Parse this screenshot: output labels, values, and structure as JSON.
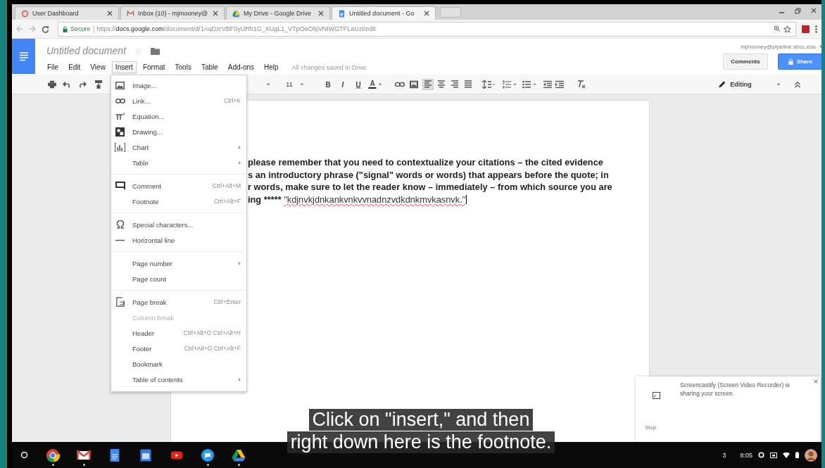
{
  "browser": {
    "tabs": [
      {
        "title": "User Dashboard",
        "selected": false
      },
      {
        "title": "Inbox (10) - mjmooney@",
        "selected": false
      },
      {
        "title": "My Drive - Google Drive",
        "selected": false
      },
      {
        "title": "Untitled document - Go",
        "selected": true
      }
    ],
    "security": "Secure",
    "url_scheme": "https://",
    "url_host": "docs.google.com",
    "url_path": "/document/d/1AqDzrVBF0yURh1G_XUgL1_VTpOeO6jVNIWGTFLaUzI/edit"
  },
  "docs": {
    "title": "Untitled document",
    "menus": [
      {
        "label": "File",
        "selected": false
      },
      {
        "label": "Edit",
        "selected": false
      },
      {
        "label": "View",
        "selected": false
      },
      {
        "label": "Insert",
        "selected": true
      },
      {
        "label": "Format",
        "selected": false
      },
      {
        "label": "Tools",
        "selected": false
      },
      {
        "label": "Table",
        "selected": false
      },
      {
        "label": "Add-ons",
        "selected": false
      },
      {
        "label": "Help",
        "selected": false
      }
    ],
    "save_status": "All changes saved in Drive",
    "account": "mjmooney@pipeline.sbcc.edu",
    "comments_button": "Comments",
    "share_button": "Share"
  },
  "toolbar": {
    "font_size": "11",
    "format_buttons": [
      "B",
      "I",
      "U",
      "A"
    ],
    "alignments": [
      {
        "kind": "left",
        "selected": true
      },
      {
        "kind": "center",
        "selected": false
      },
      {
        "kind": "right",
        "selected": false
      },
      {
        "kind": "justify",
        "selected": false
      }
    ],
    "mode": "Editing"
  },
  "insert_menu": [
    {
      "kind": "item",
      "label": "Image...",
      "submenu": false,
      "disabled": false
    },
    {
      "kind": "item",
      "label": "Link...",
      "shortcut": "Ctrl+K",
      "submenu": false,
      "disabled": false
    },
    {
      "kind": "item",
      "label": "Equation...",
      "submenu": false,
      "disabled": false
    },
    {
      "kind": "item",
      "label": "Drawing...",
      "submenu": false,
      "disabled": false
    },
    {
      "kind": "item",
      "label": "Chart",
      "submenu": true,
      "disabled": false
    },
    {
      "kind": "item",
      "label": "Table",
      "submenu": true,
      "disabled": false
    },
    {
      "kind": "separator"
    },
    {
      "kind": "item",
      "label": "Comment",
      "shortcut": "Ctrl+Alt+M",
      "submenu": false,
      "disabled": false
    },
    {
      "kind": "item",
      "label": "Footnote",
      "shortcut": "Ctrl+Alt+F",
      "submenu": false,
      "disabled": false
    },
    {
      "kind": "separator"
    },
    {
      "kind": "item",
      "label": "Special characters...",
      "submenu": false,
      "disabled": false
    },
    {
      "kind": "item",
      "label": "Horizontal line",
      "submenu": false,
      "disabled": false
    },
    {
      "kind": "separator"
    },
    {
      "kind": "item",
      "label": "Page number",
      "submenu": true,
      "disabled": false
    },
    {
      "kind": "item",
      "label": "Page count",
      "submenu": false,
      "disabled": false
    },
    {
      "kind": "separator"
    },
    {
      "kind": "item",
      "label": "Page break",
      "shortcut": "Ctrl+Enter",
      "submenu": false,
      "disabled": false
    },
    {
      "kind": "item",
      "label": "Column break",
      "submenu": false,
      "disabled": true
    },
    {
      "kind": "item",
      "label": "Header",
      "shortcut": "Ctrl+Alt+O Ctrl+Alt+H",
      "submenu": false,
      "disabled": false
    },
    {
      "kind": "item",
      "label": "Footer",
      "shortcut": "Ctrl+Alt+O Ctrl+Alt+F",
      "submenu": false,
      "disabled": false
    },
    {
      "kind": "item",
      "label": "Bookmark",
      "submenu": false,
      "disabled": false
    },
    {
      "kind": "item",
      "label": "Table of contents",
      "submenu": true,
      "disabled": false
    }
  ],
  "document": {
    "lines": [
      {
        "text": "please remember that you need to contextualize your citations – the cited evidence"
      },
      {
        "text": "s an introductory phrase (\"signal\" words or words) that appears before the quote; in"
      },
      {
        "text": "r words, make sure to let the reader know – immediately – from which source you are"
      },
      {
        "text": "ing *****",
        "misspelled": "\"kdjnvkjdnkankvnkvvnadnzvdkdnkmvkasnvk.\""
      }
    ]
  },
  "cast_notice": {
    "message": "Screencastify (Screen Video Recorder) is sharing your screen.",
    "stop": "Stop"
  },
  "captions": [
    "Click on \"insert,\" and then",
    "right down here is the footnote."
  ],
  "shelf": {
    "apps": [
      {
        "running": true
      },
      {
        "running": true
      },
      {
        "running": false
      },
      {
        "running": false
      },
      {
        "running": false
      },
      {
        "running": true
      },
      {
        "running": true
      }
    ],
    "notification_count": "3",
    "time": "8:05"
  }
}
